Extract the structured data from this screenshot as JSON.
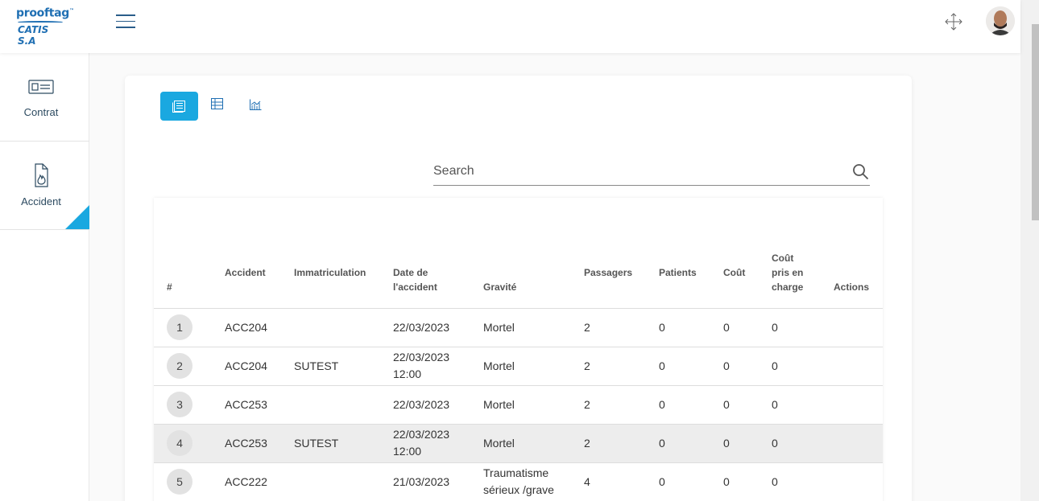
{
  "header": {
    "logo_line1": "prooftag",
    "logo_tm": "™",
    "logo_line2": "CATIS S.A"
  },
  "sidebar": {
    "items": [
      {
        "label": "Contrat",
        "icon": "id-card-icon",
        "active": false
      },
      {
        "label": "Accident",
        "icon": "document-flame-icon",
        "active": true
      }
    ]
  },
  "view_toggle": {
    "buttons": [
      {
        "icon": "list-view-icon",
        "active": true
      },
      {
        "icon": "table-view-icon",
        "active": false
      },
      {
        "icon": "chart-view-icon",
        "active": false
      }
    ]
  },
  "search": {
    "placeholder": "Search"
  },
  "table": {
    "headers": {
      "num": "#",
      "accident": "Accident",
      "immatriculation": "Immatriculation",
      "date_l1": "Date de",
      "date_l2": "l'accident",
      "gravite": "Gravité",
      "passagers": "Passagers",
      "patients": "Patients",
      "cout": "Coût",
      "cpc_l1": "Coût",
      "cpc_l2": "pris en",
      "cpc_l3": "charge",
      "actions": "Actions"
    },
    "rows": [
      {
        "num": "1",
        "accident": "ACC204",
        "immat": "",
        "date": "22/03/2023",
        "time": "",
        "gravite_l1": "Mortel",
        "gravite_l2": "",
        "passagers": "2",
        "patients": "0",
        "cout": "0",
        "cpc": "0"
      },
      {
        "num": "2",
        "accident": "ACC204",
        "immat": "SUTEST",
        "date": "22/03/2023",
        "time": "12:00",
        "gravite_l1": "Mortel",
        "gravite_l2": "",
        "passagers": "2",
        "patients": "0",
        "cout": "0",
        "cpc": "0"
      },
      {
        "num": "3",
        "accident": "ACC253",
        "immat": "",
        "date": "22/03/2023",
        "time": "",
        "gravite_l1": "Mortel",
        "gravite_l2": "",
        "passagers": "2",
        "patients": "0",
        "cout": "0",
        "cpc": "0"
      },
      {
        "num": "4",
        "accident": "ACC253",
        "immat": "SUTEST",
        "date": "22/03/2023",
        "time": "12:00",
        "gravite_l1": "Mortel",
        "gravite_l2": "",
        "passagers": "2",
        "patients": "0",
        "cout": "0",
        "cpc": "0"
      },
      {
        "num": "5",
        "accident": "ACC222",
        "immat": "",
        "date": "21/03/2023",
        "time": "",
        "gravite_l1": "Traumatisme",
        "gravite_l2": "sérieux /grave",
        "passagers": "4",
        "patients": "0",
        "cout": "0",
        "cpc": "0"
      }
    ]
  },
  "colors": {
    "accent": "#1aa8e0",
    "brand": "#1f6fb3",
    "highlight_row": "#ededed"
  }
}
